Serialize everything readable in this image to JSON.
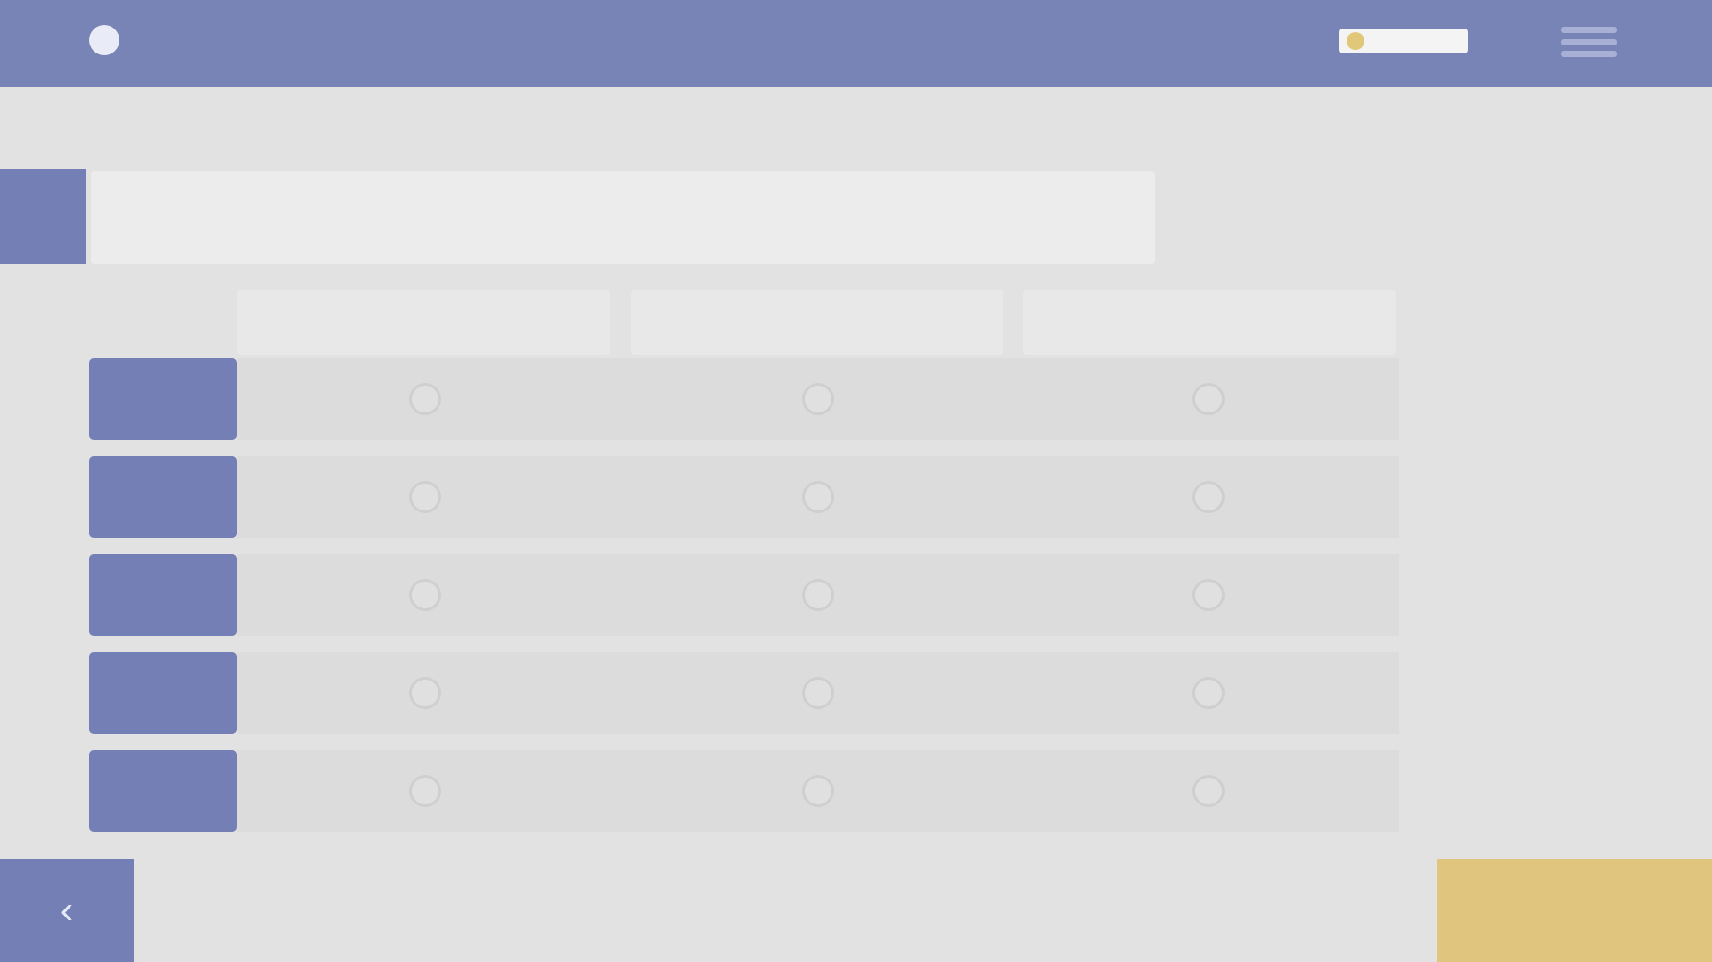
{
  "topbar": {
    "brand": "",
    "subtitle": "",
    "link": "",
    "menu_icon": "hamburger-menu-icon",
    "background_color": "#7884b6",
    "accent_color": "#e1c878"
  },
  "question": {
    "number": "",
    "prompt": ""
  },
  "table": {
    "columns": [
      "",
      "",
      ""
    ],
    "rows": [
      {
        "label": ""
      },
      {
        "label": ""
      },
      {
        "label": ""
      },
      {
        "label": ""
      },
      {
        "label": ""
      }
    ]
  },
  "footer": {
    "prev_icon": "chevron-left-icon",
    "prev_glyph": "‹",
    "submit_label": "",
    "submit_color": "#dfc57e"
  }
}
